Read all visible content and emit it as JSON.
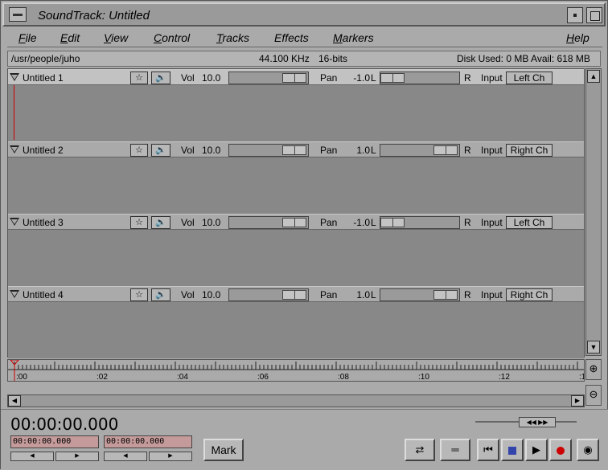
{
  "window": {
    "title": "SoundTrack: Untitled"
  },
  "menu": [
    {
      "label": "File",
      "key": "F",
      "rest": "ile"
    },
    {
      "label": "Edit",
      "key": "E",
      "rest": "dit"
    },
    {
      "label": "View",
      "key": "V",
      "rest": "iew"
    },
    {
      "label": "Control",
      "key": "C",
      "rest": "ontrol"
    },
    {
      "label": "Tracks",
      "key": "T",
      "rest": "racks"
    },
    {
      "label": "Effects",
      "key": "",
      "rest": "Effects"
    },
    {
      "label": "Markers",
      "key": "M",
      "rest": "arkers"
    },
    {
      "label": "Help",
      "key": "H",
      "rest": "elp"
    }
  ],
  "info": {
    "path": "/usr/people/juho",
    "rate": "44.100 KHz",
    "bits": "16-bits",
    "disk": "Disk Used: 0 MB Avail: 618 MB"
  },
  "tracks": [
    {
      "name": "Untitled 1",
      "vol_label": "Vol",
      "vol": "10.0",
      "pan_label": "Pan",
      "pan": "-1.0",
      "pan_value": -1.0,
      "l": "L",
      "r": "R",
      "input_label": "Input",
      "input": "Left Ch",
      "selected": true
    },
    {
      "name": "Untitled 2",
      "vol_label": "Vol",
      "vol": "10.0",
      "pan_label": "Pan",
      "pan": "1.0",
      "pan_value": 1.0,
      "l": "L",
      "r": "R",
      "input_label": "Input",
      "input": "Right Ch",
      "selected": false
    },
    {
      "name": "Untitled 3",
      "vol_label": "Vol",
      "vol": "10.0",
      "pan_label": "Pan",
      "pan": "-1.0",
      "pan_value": -1.0,
      "l": "L",
      "r": "R",
      "input_label": "Input",
      "input": "Left Ch",
      "selected": false
    },
    {
      "name": "Untitled 4",
      "vol_label": "Vol",
      "vol": "10.0",
      "pan_label": "Pan",
      "pan": "1.0",
      "pan_value": 1.0,
      "l": "L",
      "r": "R",
      "input_label": "Input",
      "input": "Right Ch",
      "selected": false
    }
  ],
  "timeline": {
    "labels": [
      ":00",
      ":02",
      ":04",
      ":06",
      ":08",
      ":10",
      ":12",
      ":1"
    ]
  },
  "transport": {
    "time": "00:00:00.000",
    "start": "00:00:00.000",
    "end": "00:00:00.000",
    "mark": "Mark"
  },
  "icons": {
    "star": "star-icon",
    "speaker": "speaker-icon",
    "zoom_in": "zoom-in-icon",
    "zoom_out": "zoom-out-icon",
    "rewind": "rewind-icon",
    "stop": "stop-icon",
    "play": "play-icon",
    "record": "record-icon",
    "loop": "loop-icon",
    "monitor": "monitor-icon"
  },
  "colors": {
    "record": "#cc0000",
    "stop": "#3344aa",
    "time_field": "#c49a9a",
    "playhead": "#cc0000"
  }
}
